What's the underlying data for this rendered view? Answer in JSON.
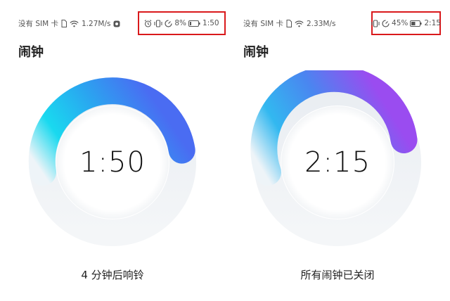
{
  "left_screen": {
    "status_bar": {
      "carrier": "没有 SIM 卡",
      "speed": "1.27M/s",
      "battery_percent": "8%",
      "time": "1:50",
      "icons_left": [
        "sim-icon",
        "wifi-icon",
        "notification-icon"
      ],
      "icons_right": [
        "alarm-icon",
        "vibrate-icon",
        "data-saver-icon",
        "battery-icon"
      ]
    },
    "app_title": "闹钟",
    "dial_time": "1:50",
    "caption": "4 分钟后响铃",
    "arc": {
      "start_color": "#16d4ee",
      "end_color": "#4a6cf2"
    }
  },
  "right_screen": {
    "status_bar": {
      "carrier": "没有 SIM 卡",
      "speed": "2.33M/s",
      "battery_percent": "45%",
      "time": "2:15",
      "icons_left": [
        "sim-icon",
        "wifi-icon"
      ],
      "icons_right": [
        "vibrate-icon",
        "data-saver-icon",
        "battery-icon"
      ]
    },
    "app_title": "闹钟",
    "dial_time": "2:15",
    "caption": "所有闹钟已关闭",
    "arc": {
      "start_color": "#2fb6ef",
      "end_color": "#9a4cf0"
    }
  }
}
